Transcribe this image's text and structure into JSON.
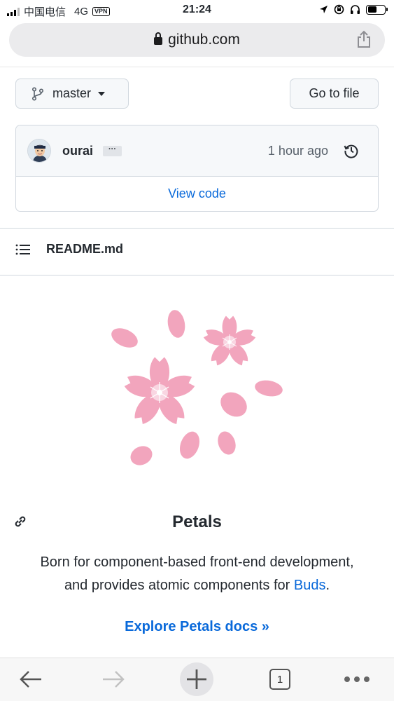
{
  "status_bar": {
    "carrier": "中国电信",
    "network": "4G",
    "vpn": "VPN",
    "time": "21:24"
  },
  "browser": {
    "url": "github.com",
    "tab_count": "1"
  },
  "repo": {
    "branch_label": "master",
    "go_to_file_label": "Go to file",
    "commit_author": "ourai",
    "commit_ellipsis": "···",
    "commit_time": "1 hour ago",
    "view_code_label": "View code",
    "readme_filename": "README.md"
  },
  "readme": {
    "title": "Petals",
    "description_prefix": "Born for component-based front-end development, and provides atomic components for ",
    "description_link": "Buds",
    "description_suffix": ".",
    "explore_link": "Explore Petals docs »"
  },
  "colors": {
    "accent": "#0969da",
    "petal_pink": "#f2a5bd",
    "petal_light": "#f6c3d3"
  },
  "icons": {
    "branch": "git-branch-icon",
    "history": "history-icon",
    "list": "list-icon",
    "link": "link-icon",
    "share": "share-icon",
    "lock": "lock-icon"
  }
}
